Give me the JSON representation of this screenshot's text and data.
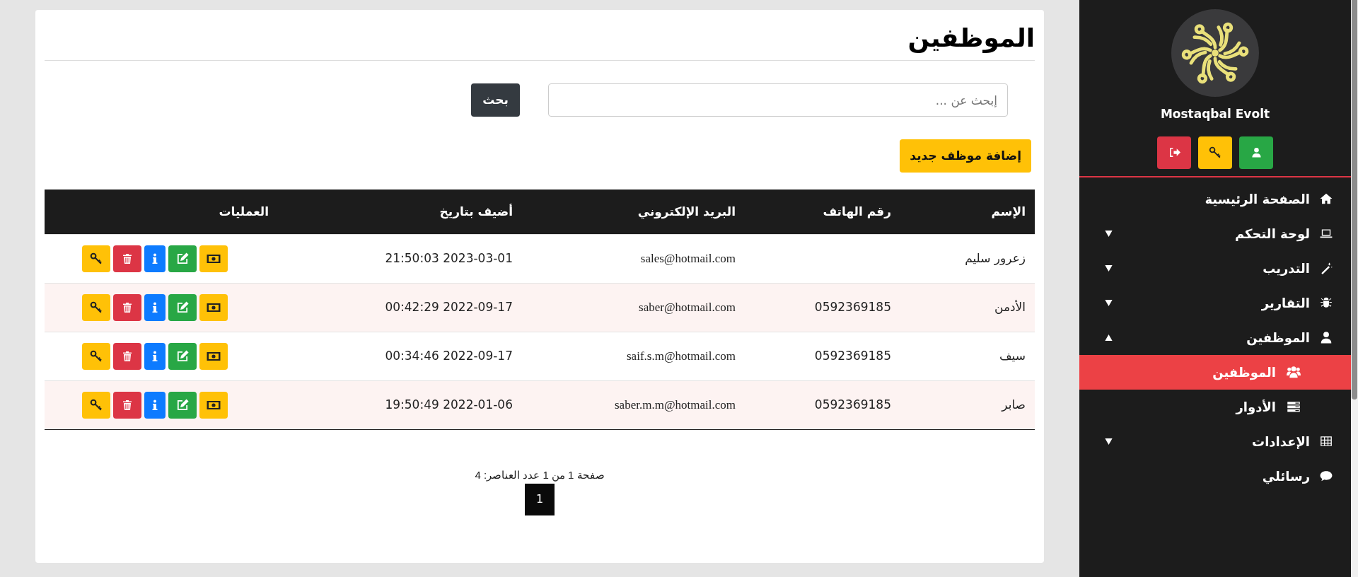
{
  "page": {
    "title": "الموظفين"
  },
  "search": {
    "placeholder": "إبحث عن ...",
    "button": "بحث"
  },
  "add_button": "إضافة موظف جديد",
  "table": {
    "columns": [
      "الإسم",
      "رقم الهاتف",
      "البريد الإلكتروني",
      "أضيف بتاريخ",
      "العمليات"
    ],
    "rows": [
      {
        "name": "زعرور سليم",
        "email": "sales@hotmail.com",
        "added": "21:50:03 2023-03-01"
      },
      {
        "name": "الأدمن",
        "phone": "0592369185",
        "email": "saber@hotmail.com",
        "added": "00:42:29 2022-09-17"
      },
      {
        "name": "سيف",
        "phone": "0592369185",
        "email": "saif.s.m@hotmail.com",
        "added": "00:34:46 2022-09-17"
      },
      {
        "name": "صابر",
        "phone": "0592369185",
        "email": "saber.m.m@hotmail.com",
        "added": "19:50:49 2022-01-06"
      }
    ]
  },
  "pagination": {
    "summary": "صفحة 1 من 1 عدد العناصر: 4",
    "pages": [
      {
        "label": "1",
        "selected": true
      }
    ]
  },
  "sidebar": {
    "brand": "Mostaqbal Evolt",
    "items": [
      {
        "label": "الصفحة الرئيسية",
        "kind": "link"
      },
      {
        "label": "لوحة التحكم",
        "kind": "group",
        "expanded": false
      },
      {
        "label": "التدريب",
        "kind": "group",
        "expanded": false
      },
      {
        "label": "التقارير",
        "kind": "group",
        "expanded": false
      },
      {
        "label": "الموظفين",
        "kind": "group",
        "expanded": true,
        "children": [
          {
            "label": "الموظفين",
            "selected": true
          },
          {
            "label": "الأدوار",
            "selected": false
          }
        ]
      },
      {
        "label": "الإعدادات",
        "kind": "group",
        "expanded": false
      },
      {
        "label": "رسائلي",
        "kind": "link"
      }
    ]
  }
}
